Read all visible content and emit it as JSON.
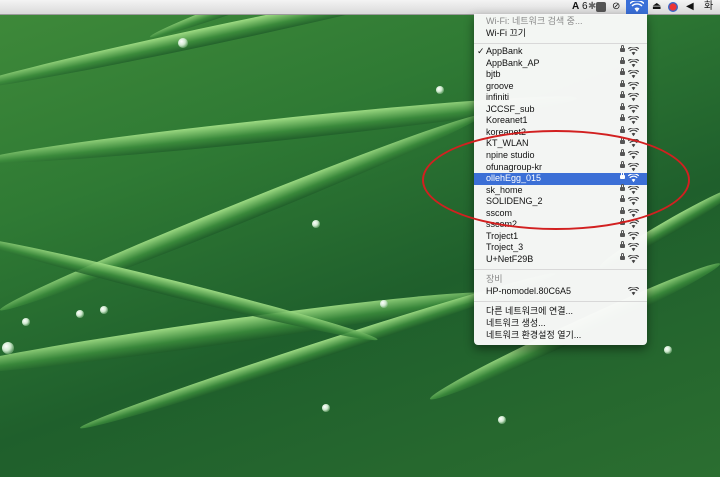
{
  "menubar": {
    "input_source": "A",
    "battery_label": "6",
    "clock_text": "화"
  },
  "menu": {
    "status": "Wi-Fi: 네트워크 검색 중...",
    "toggle": "Wi-Fi 끄기",
    "networks": [
      {
        "name": "AppBank",
        "checked": true,
        "locked": true
      },
      {
        "name": "AppBank_AP",
        "locked": true
      },
      {
        "name": "bjtb",
        "locked": true
      },
      {
        "name": "groove",
        "locked": true
      },
      {
        "name": "infiniti",
        "locked": true
      },
      {
        "name": "JCCSF_sub",
        "locked": true
      },
      {
        "name": "Koreanet1",
        "locked": true
      },
      {
        "name": "koreanet2",
        "locked": true
      },
      {
        "name": "KT_WLAN",
        "locked": true
      },
      {
        "name": "npine studio",
        "locked": true
      },
      {
        "name": "ofunagroup-kr",
        "locked": true
      },
      {
        "name": "ollehEgg_015",
        "locked": true,
        "selected": true
      },
      {
        "name": "sk_home",
        "locked": true
      },
      {
        "name": "SOLIDENG_2",
        "locked": true
      },
      {
        "name": "sscom",
        "locked": true
      },
      {
        "name": "sscom2",
        "locked": true
      },
      {
        "name": "Troject1",
        "locked": true
      },
      {
        "name": "Troject_3",
        "locked": true
      },
      {
        "name": "U+NetF29B",
        "locked": true
      }
    ],
    "devices_header": "장비",
    "device": "HP-nomodel.80C6A5",
    "actions": [
      "다른 네트워크에 연결...",
      "네트워크 생성...",
      "네트워크 환경설정 열기..."
    ]
  }
}
